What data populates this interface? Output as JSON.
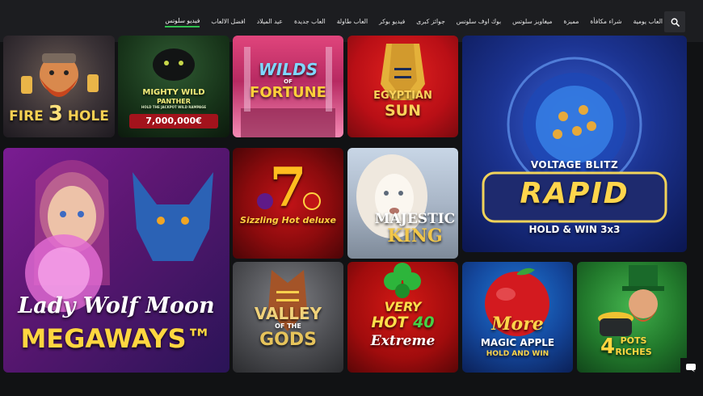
{
  "nav": {
    "items": [
      {
        "label": "فيديو سلوتس",
        "active": true
      },
      {
        "label": "افضل الالعاب"
      },
      {
        "label": "عيد الميلاد"
      },
      {
        "label": "العاب جديدة"
      },
      {
        "label": "العاب طاولة"
      },
      {
        "label": "فيديو بوكر"
      },
      {
        "label": "جوائز كبرى"
      },
      {
        "label": "بوك اوف سلوتس"
      },
      {
        "label": "ميغاويز سلوتس"
      },
      {
        "label": "مميزة"
      },
      {
        "label": "شراء مكافأة"
      },
      {
        "label": "العاب يومية"
      }
    ],
    "search_icon": "search-icon"
  },
  "games": {
    "fire_hole": {
      "title": "FIRE",
      "num": "3",
      "sub": "HOLE",
      "the": "IN THE"
    },
    "mighty_wild": {
      "line1": "MIGHTY",
      "line2": "WILD",
      "line3": "PANTHER",
      "tagline": "HOLD THE JACKPOT WILD RAMPAGE",
      "badge": "7,000,000€"
    },
    "wilds_fortune": {
      "line1": "WILDS",
      "of": "OF",
      "line2": "FORTUNE"
    },
    "egyptian_sun": {
      "line1": "EGYPTIAN",
      "line2": "SUN"
    },
    "rapid": {
      "brand": "VOLTAGE BLITZ",
      "title": "RAPID",
      "sub": "HOLD & WIN 3x3"
    },
    "lady_wolf": {
      "line1": "Lady Wolf Moon",
      "line2": "MEGAWAYS™"
    },
    "sizzling_hot": {
      "num": "7",
      "title": "Sizzling Hot deluxe"
    },
    "majestic_king": {
      "line1": "MAJESTIC",
      "line2": "KING"
    },
    "valley_gods": {
      "line1": "VALLEY",
      "of": "OF THE",
      "line2": "GODS"
    },
    "very_hot": {
      "line1": "VERY",
      "line2": "HOT",
      "num": "40",
      "line3": "Extreme"
    },
    "magic_apple": {
      "line1": "More",
      "line2": "MAGIC APPLE",
      "line3": "HOLD AND WIN"
    },
    "pots_riches": {
      "num": "4",
      "line1": "POTS",
      "line2": "RICHES"
    }
  },
  "chat_icon": "chat-bubble-icon"
}
